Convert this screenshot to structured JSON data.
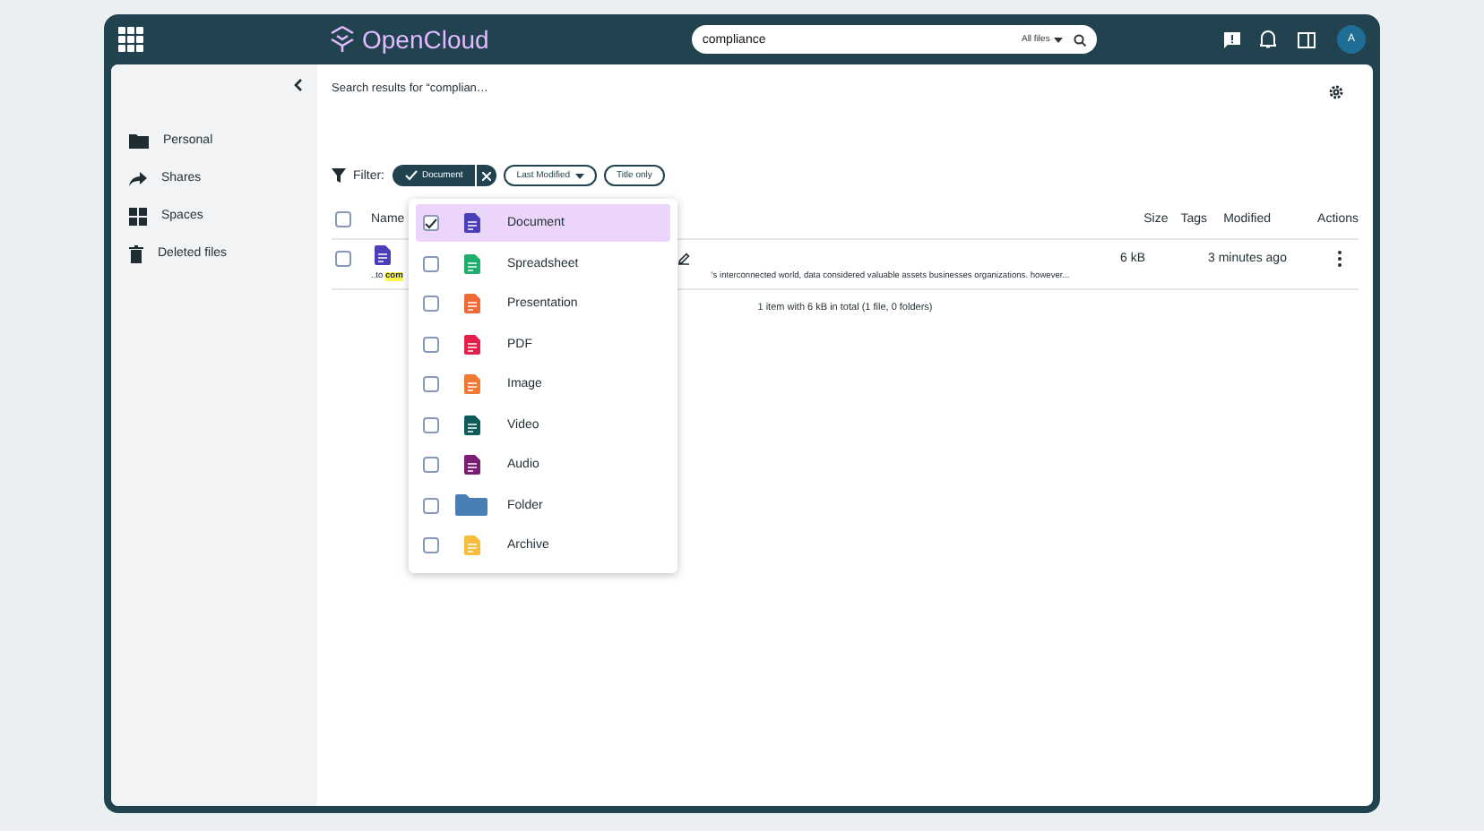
{
  "topbar": {
    "app_name": "OpenCloud",
    "search": {
      "value": "compliance",
      "scope": "All files"
    },
    "avatar": "A"
  },
  "sidebar": {
    "items": [
      {
        "label": "Personal",
        "kind": "folder"
      },
      {
        "label": "Shares",
        "kind": "share"
      },
      {
        "label": "Spaces",
        "kind": "spaces"
      },
      {
        "label": "Deleted files",
        "kind": "trash"
      }
    ]
  },
  "main": {
    "title": "Search results for “complian…",
    "filter_label": "Filter:",
    "filters": [
      {
        "kind": "chip",
        "label": "Document",
        "active": true
      },
      {
        "kind": "dropdown",
        "label": "Last Modified"
      },
      {
        "kind": "toggle",
        "label": "Title only",
        "on": false
      }
    ],
    "table": {
      "select_all": {
        "checked": false
      },
      "columns": [
        "Name",
        "Size",
        "Tags",
        "Modified",
        "Actions"
      ],
      "rows": [
        {
          "selected": false,
          "snippet_start": "..to",
          "match": "com",
          "snippet_end": "'s interconnected world, data considered valuable assets businesses organizations. however...",
          "size": "6 kB",
          "modified": "3 minutes ago"
        }
      ]
    },
    "footer": "1 item with 6 kB in total (1 file, 0 folders)"
  },
  "type_menu": {
    "items": [
      {
        "label": "Document",
        "kind": "document",
        "checked": true
      },
      {
        "label": "Spreadsheet",
        "kind": "spreadsheet",
        "checked": false
      },
      {
        "label": "Presentation",
        "kind": "presentation",
        "checked": false
      },
      {
        "label": "PDF",
        "kind": "pdf",
        "checked": false
      },
      {
        "label": "Image",
        "kind": "image",
        "checked": false
      },
      {
        "label": "Video",
        "kind": "video",
        "checked": false
      },
      {
        "label": "Audio",
        "kind": "audio",
        "checked": false
      },
      {
        "label": "Folder",
        "kind": "folder",
        "checked": false
      },
      {
        "label": "Archive",
        "kind": "archive",
        "checked": false
      }
    ]
  }
}
